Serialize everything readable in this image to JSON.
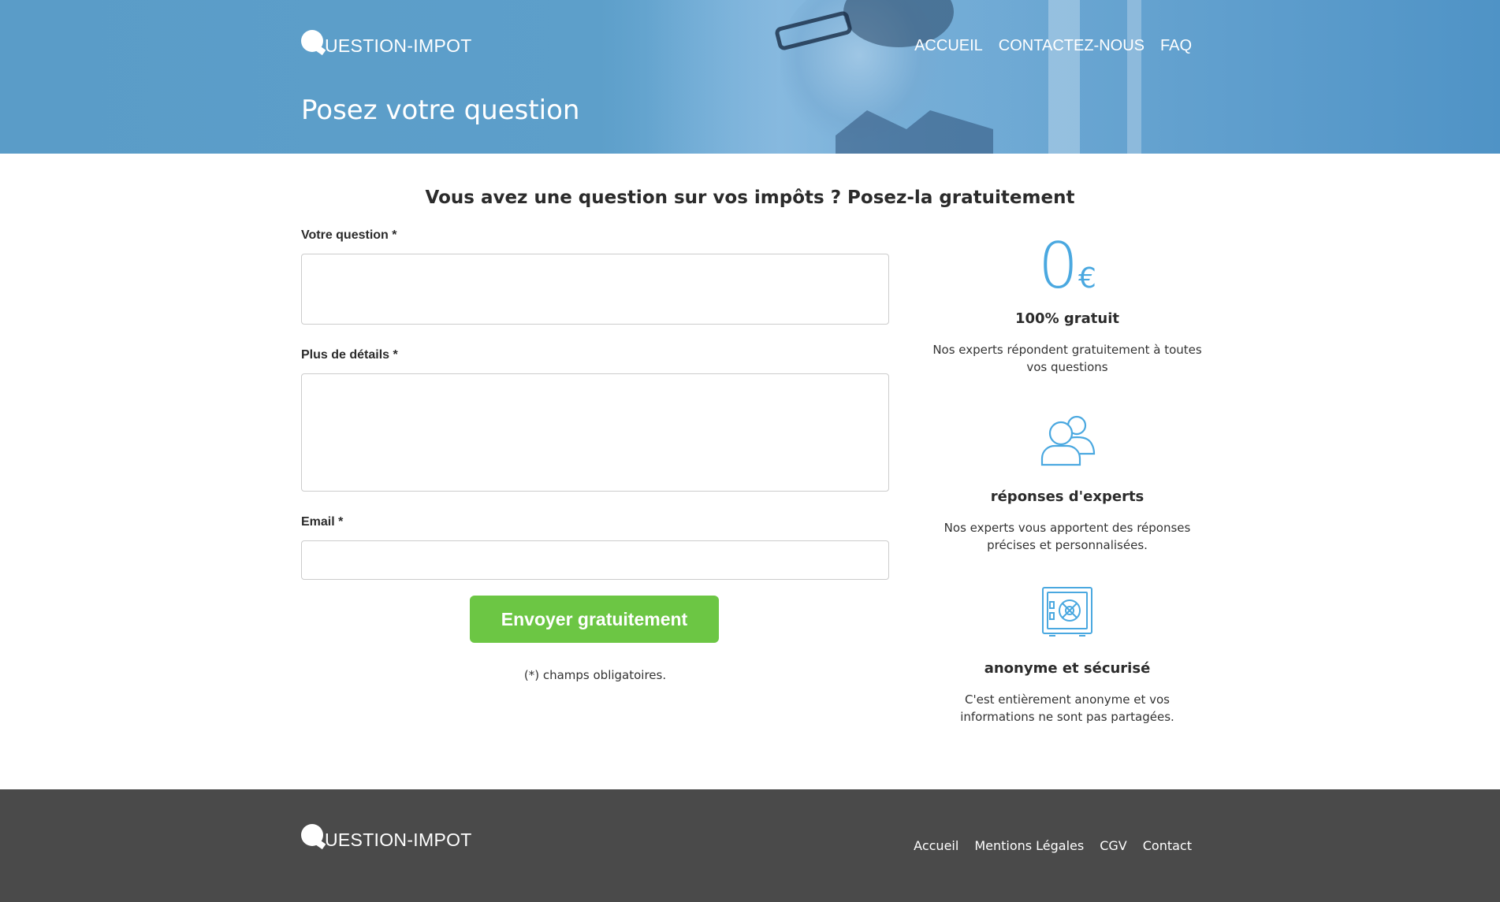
{
  "header": {
    "logo_text": "UESTION-IMPOT",
    "logo_letter": "Q",
    "nav": [
      "ACCUEIL",
      "CONTACTEZ-NOUS",
      "FAQ"
    ],
    "page_title": "Posez votre question"
  },
  "main": {
    "subtitle": "Vous avez une question sur vos impôts ? Posez-la gratuitement",
    "form": {
      "question_label": "Votre question *",
      "question_value": "",
      "details_label": "Plus de détails *",
      "details_value": "",
      "email_label": "Email *",
      "email_value": "",
      "submit_label": "Envoyer gratuitement",
      "note": "(*) champs obligatoires."
    },
    "features": [
      {
        "icon": "euro-zero-icon",
        "icon_text_zero": "0",
        "icon_text_currency": "€",
        "title": "100% gratuit",
        "description": "Nos experts répondent gratuitement à toutes vos questions"
      },
      {
        "icon": "users-icon",
        "title": "réponses d'experts",
        "description": "Nos experts vous apportent des réponses précises et personnalisées."
      },
      {
        "icon": "safe-icon",
        "title": "anonyme et sécurisé",
        "description": "C'est entièrement anonyme et vos informations ne sont pas partagées."
      }
    ]
  },
  "footer": {
    "logo_text": "UESTION-IMPOT",
    "links": [
      "Accueil",
      "Mentions Légales",
      "CGV",
      "Contact"
    ]
  },
  "colors": {
    "header_blue": "#5a9cc8",
    "accent_blue": "#4aa8e0",
    "button_green": "#6cc644",
    "footer_gray": "#4a4a4a"
  }
}
